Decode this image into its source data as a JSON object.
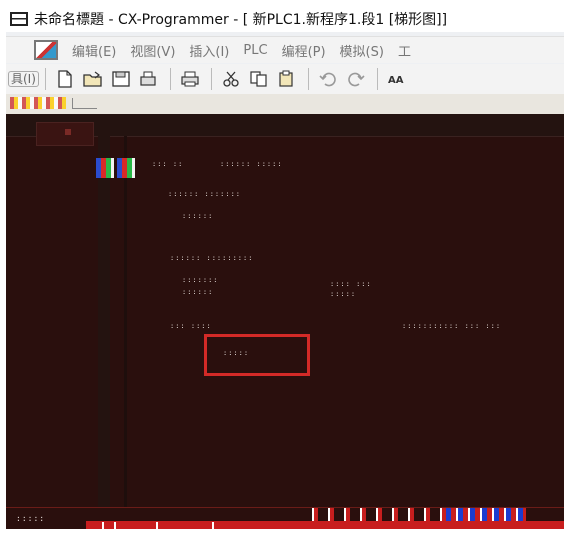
{
  "window": {
    "title": "未命名標題 - CX-Programmer - [ 新PLC1.新程序1.段1 [梯形图]]"
  },
  "menu": {
    "items": [
      "编辑(E)",
      "视图(V)",
      "插入(I)",
      "PLC",
      "编程(P)",
      "模拟(S)",
      "工"
    ]
  },
  "toolbar": {
    "grip_label": "具(I)",
    "buttons": [
      {
        "icon": "new-file-icon"
      },
      {
        "icon": "open-folder-icon"
      },
      {
        "icon": "save-icon"
      },
      {
        "icon": "print-preview-icon"
      },
      {
        "icon": "print-icon"
      },
      {
        "icon": "cut-icon"
      },
      {
        "icon": "copy-icon"
      },
      {
        "icon": "paste-icon"
      },
      {
        "icon": "undo-icon"
      },
      {
        "icon": "redo-icon"
      },
      {
        "icon": "find-icon"
      }
    ]
  },
  "ladder": {
    "tab_label": "",
    "rung_texts": [
      {
        "id": "r1a",
        "text": "::: ::"
      },
      {
        "id": "r1b",
        "text": ":::::: :::::"
      },
      {
        "id": "r1c",
        "text": "::::::"
      },
      {
        "id": "r2a",
        "text": ":::::: :::::::"
      },
      {
        "id": "r2b",
        "text": ":::::::"
      },
      {
        "id": "r2c",
        "text": ":::: :::"
      },
      {
        "id": "r3a",
        "text": ":::::: :::::::::"
      },
      {
        "id": "r3b",
        "text": "::::::"
      },
      {
        "id": "r3c",
        "text": ":::::"
      },
      {
        "id": "r4a",
        "text": "::: ::::"
      },
      {
        "id": "r4b",
        "text": "::::::::::: ::: :::"
      },
      {
        "id": "sel",
        "text": ":::::"
      }
    ]
  },
  "status": {
    "left_text": ":::::"
  },
  "colors": {
    "ladder_bg": "#2a0f0d",
    "selection_border": "#d32a27",
    "rung_text": "#e9e1dd"
  }
}
